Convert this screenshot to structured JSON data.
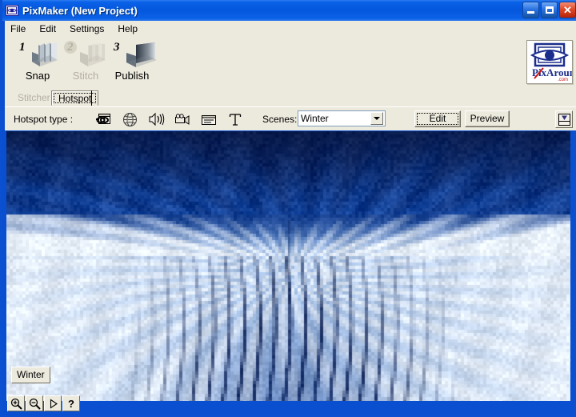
{
  "window": {
    "title": "PixMaker (New Project)",
    "icon": "pixmaker-app-icon",
    "controls": {
      "minimize": "minimize-icon",
      "maximize": "maximize-icon",
      "close": "close-icon"
    }
  },
  "menu": {
    "items": [
      {
        "label": "File"
      },
      {
        "label": "Edit"
      },
      {
        "label": "Settings"
      },
      {
        "label": "Help"
      }
    ]
  },
  "toolbar": {
    "buttons": [
      {
        "number": "1",
        "label": "Snap",
        "enabled": true
      },
      {
        "number": "2",
        "label": "Stitch",
        "enabled": false
      },
      {
        "number": "3",
        "label": "Publish",
        "enabled": true
      }
    ],
    "logo": {
      "name": "pixaround-logo",
      "text": "PixAround",
      "suffix": ".com"
    }
  },
  "tabs": [
    {
      "label": "Stitcher",
      "active": false,
      "enabled": false
    },
    {
      "label": "Hotspot",
      "active": true,
      "enabled": true
    }
  ],
  "hotspot_bar": {
    "label": "Hotspot type :",
    "types": [
      {
        "name": "link-window-icon",
        "title": "Link"
      },
      {
        "name": "globe-icon",
        "title": "URL"
      },
      {
        "name": "sound-icon",
        "title": "Sound"
      },
      {
        "name": "video-camera-icon",
        "title": "Video"
      },
      {
        "name": "textbox-icon",
        "title": "Text box"
      },
      {
        "name": "text-t-icon",
        "title": "Text"
      }
    ],
    "scenes_label": "Scenes:",
    "scenes_value": "Winter",
    "scenes_options": [
      "Winter"
    ],
    "edit_label": "Edit",
    "preview_label": "Preview",
    "save_icon": "save-export-icon"
  },
  "viewer": {
    "scene_tag": "Winter",
    "nav": [
      {
        "name": "zoom-in-button",
        "icon": "zoom-in-icon",
        "label": ""
      },
      {
        "name": "zoom-out-button",
        "icon": "zoom-out-icon",
        "label": ""
      },
      {
        "name": "play-button",
        "icon": "play-icon",
        "label": ""
      },
      {
        "name": "help-button",
        "icon": "question-icon",
        "label": "?"
      }
    ]
  },
  "colors": {
    "titlebar_blue": "#0457DC",
    "window_border": "#0A50D0",
    "toolbar_beige": "#ECE9DD",
    "close_red": "#E04A28",
    "pano_sky": "#1A4FA0",
    "pano_snow": "#E6EEF8",
    "logo_blue": "#1B2E8C",
    "logo_red": "#CC1111"
  }
}
